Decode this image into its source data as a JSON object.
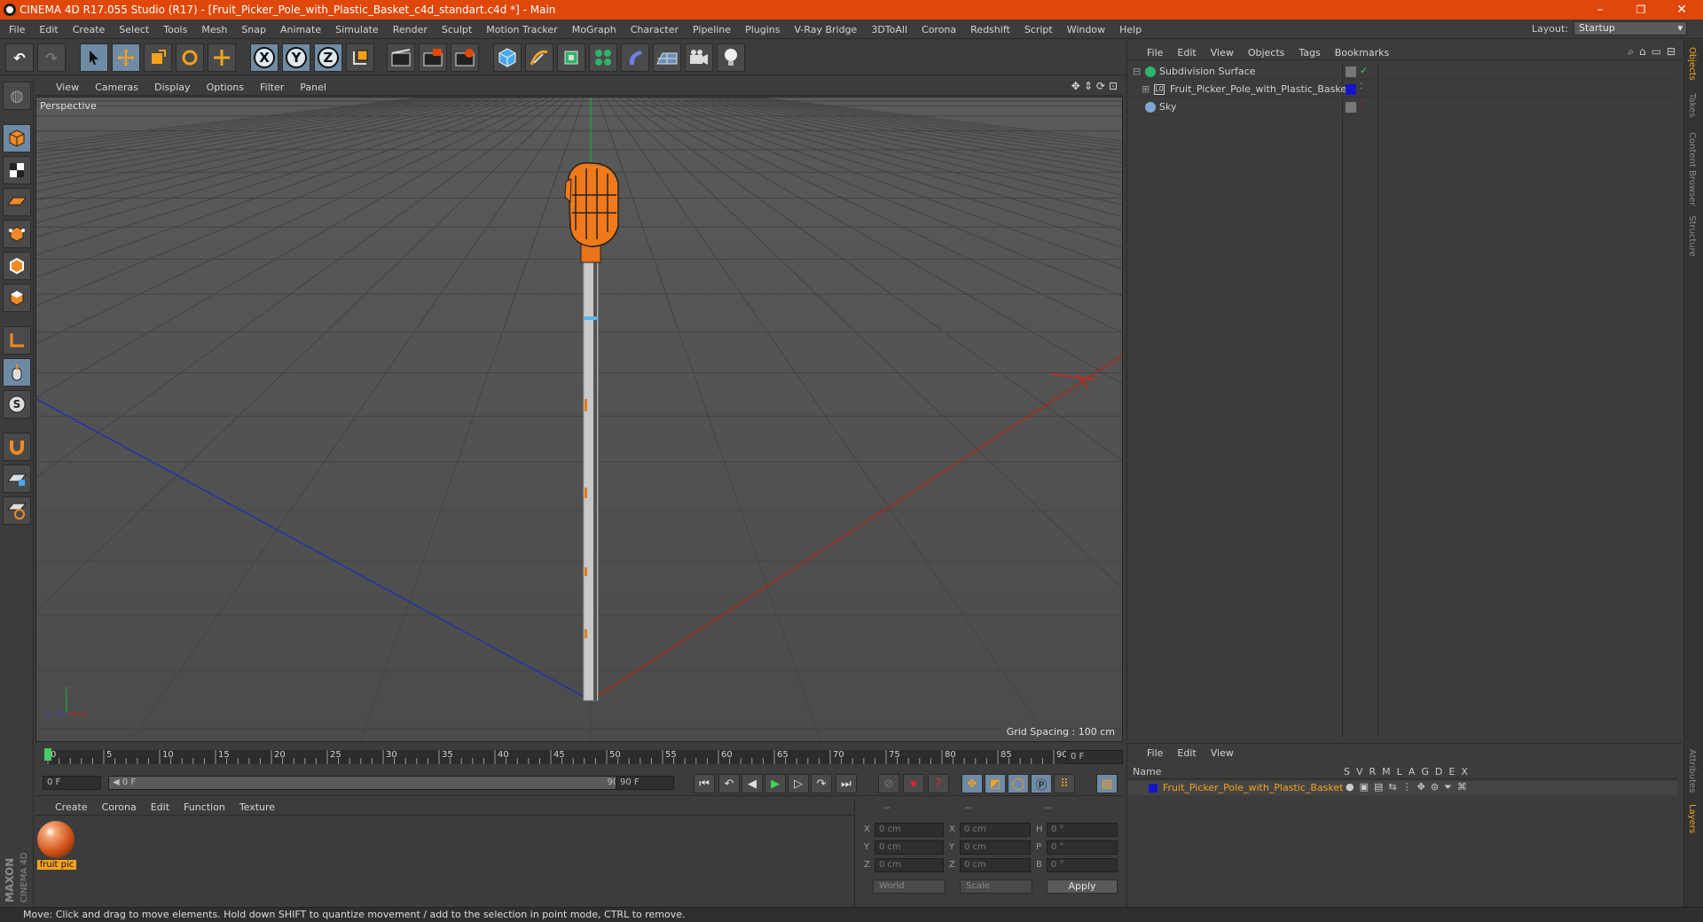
{
  "window": {
    "title": "CINEMA 4D R17.055 Studio (R17) - [Fruit_Picker_Pole_with_Plastic_Basket_c4d_standart.c4d *] - Main",
    "min": "–",
    "restore": "❐",
    "close": "✕"
  },
  "menu": [
    "File",
    "Edit",
    "Create",
    "Select",
    "Tools",
    "Mesh",
    "Snap",
    "Animate",
    "Simulate",
    "Render",
    "Sculpt",
    "Motion Tracker",
    "MoGraph",
    "Character",
    "Pipeline",
    "Plugins",
    "V-Ray Bridge",
    "3DToAll",
    "Corona",
    "Redshift",
    "Script",
    "Window",
    "Help"
  ],
  "layout": {
    "label": "Layout:",
    "value": "Startup"
  },
  "toolbar": {
    "axis_x": "X",
    "axis_y": "Y",
    "axis_z": "Z"
  },
  "viewport": {
    "menu": [
      "View",
      "Cameras",
      "Display",
      "Options",
      "Filter",
      "Panel"
    ],
    "label": "Perspective",
    "grid_spacing": "Grid Spacing : 100 cm"
  },
  "timeline": {
    "ticks": [
      "0",
      "5",
      "10",
      "15",
      "20",
      "25",
      "30",
      "35",
      "40",
      "45",
      "50",
      "55",
      "60",
      "65",
      "70",
      "75",
      "80",
      "85",
      "90"
    ],
    "end_field": "0 F"
  },
  "transport": {
    "start": "0 F",
    "slider_start": "◀ 0 F",
    "slider_end": "90 F ▶",
    "end": "90 F"
  },
  "material": {
    "menu": [
      "Create",
      "Corona",
      "Edit",
      "Function",
      "Texture"
    ],
    "item": "fruit pic"
  },
  "coords": {
    "dash": "--",
    "rows": [
      {
        "a": "X",
        "v1": "0 cm",
        "b": "X",
        "v2": "0 cm",
        "c": "H",
        "v3": "0 °"
      },
      {
        "a": "Y",
        "v1": "0 cm",
        "b": "Y",
        "v2": "0 cm",
        "c": "P",
        "v3": "0 °"
      },
      {
        "a": "Z",
        "v1": "0 cm",
        "b": "Z",
        "v2": "0 cm",
        "c": "B",
        "v3": "0 °"
      }
    ],
    "world": "World",
    "scale": "Scale",
    "apply": "Apply"
  },
  "objects": {
    "menu": [
      "File",
      "Edit",
      "View",
      "Objects",
      "Tags",
      "Bookmarks"
    ],
    "items": [
      "Subdivision Surface",
      "Fruit_Picker_Pole_with_Plastic_Basket",
      "Sky"
    ]
  },
  "layers": {
    "menu": [
      "File",
      "Edit",
      "View"
    ],
    "header_name": "Name",
    "cols": [
      "S",
      "V",
      "R",
      "M",
      "L",
      "A",
      "G",
      "D",
      "E",
      "X"
    ],
    "item": "Fruit_Picker_Pole_with_Plastic_Basket"
  },
  "right_tabs": [
    "Objects",
    "Takes",
    "Content Browser",
    "Structure",
    "Attributes",
    "Layers"
  ],
  "brand": {
    "maxon": "MAXON",
    "c4d": "CINEMA 4D"
  },
  "status": "Move: Click and drag to move elements. Hold down SHIFT to quantize movement / add to the selection in point mode, CTRL to remove.",
  "colors": {
    "accent": "#e0480b",
    "selected": "#6f8aa4",
    "layer_color": "#1515c8"
  }
}
